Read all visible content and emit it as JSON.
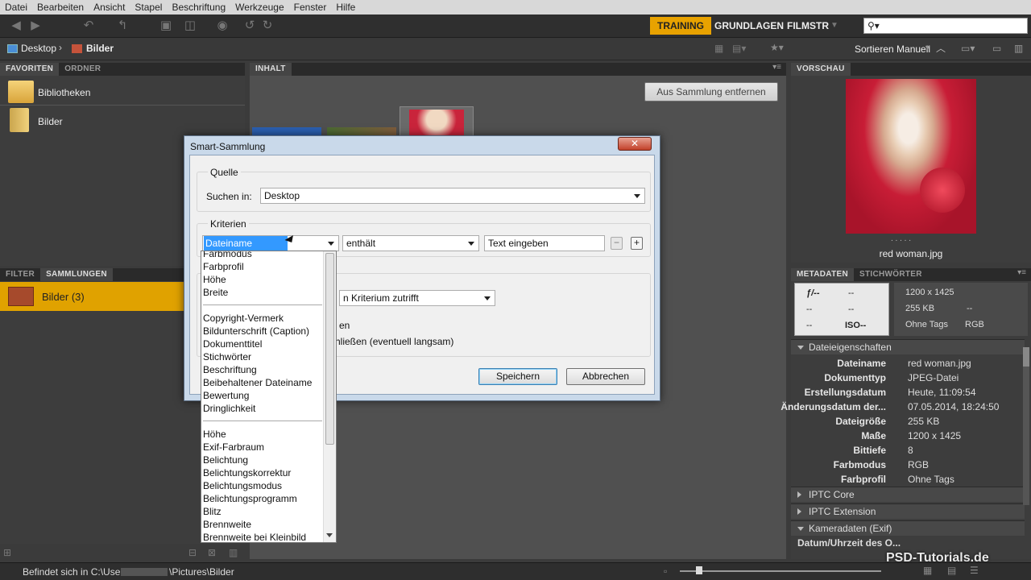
{
  "menu": [
    "Datei",
    "Bearbeiten",
    "Ansicht",
    "Stapel",
    "Beschriftung",
    "Werkzeuge",
    "Fenster",
    "Hilfe"
  ],
  "workspaces": {
    "training": "TRAINING",
    "grundlagen": "GRUNDLAGEN",
    "filmstr": "FILMSTR"
  },
  "path": {
    "desktop": "Desktop",
    "bilder": "Bilder"
  },
  "sort_label": "Sortieren Manuell",
  "favorites": {
    "tab1": "FAVORITEN",
    "tab2": "ORDNER",
    "items": [
      "Bibliotheken",
      "Bilder"
    ]
  },
  "content": {
    "tab": "INHALT",
    "remove_button": "Aus Sammlung entfernen"
  },
  "collections": {
    "tab1": "FILTER",
    "tab2": "SAMMLUNGEN",
    "item": "Bilder (3)"
  },
  "preview": {
    "tab": "VORSCHAU",
    "filename": "red woman.jpg",
    "dots": ". . . . ."
  },
  "metadata": {
    "tab1": "METADATEN",
    "tab2": "STICHWÖRTER",
    "summary": {
      "f": "ƒ/--",
      "f_val": "--",
      "r2a": "--",
      "r2b": "--",
      "r3a": "--",
      "iso": "ISO--",
      "dims": "1200 x 1425",
      "size": "255 KB",
      "size2": "--",
      "tags": "Ohne Tags",
      "mode": "RGB"
    },
    "section_file": "Dateieigenschaften",
    "rows": [
      {
        "k": "Dateiname",
        "v": "red woman.jpg"
      },
      {
        "k": "Dokumenttyp",
        "v": "JPEG-Datei"
      },
      {
        "k": "Erstellungsdatum",
        "v": "Heute, 11:09:54"
      },
      {
        "k": "Änderungsdatum der...",
        "v": "07.05.2014, 18:24:50"
      },
      {
        "k": "Dateigröße",
        "v": "255 KB"
      },
      {
        "k": "Maße",
        "v": "1200 x 1425"
      },
      {
        "k": "Bittiefe",
        "v": "8"
      },
      {
        "k": "Farbmodus",
        "v": "RGB"
      },
      {
        "k": "Farbprofil",
        "v": "Ohne Tags"
      }
    ],
    "sections": [
      "IPTC Core",
      "IPTC Extension",
      "Kameradaten (Exif)"
    ],
    "last_row": "Datum/Uhrzeit des O..."
  },
  "status": {
    "prefix": "Befindet sich in C:\\Users\\",
    "suffix": "\\Pictures\\Bilder"
  },
  "watermark": "PSD-Tutorials.de",
  "dialog": {
    "title": "Smart-Sammlung",
    "source_group": "Quelle",
    "search_in_label": "Suchen in:",
    "search_in_value": "Desktop",
    "criteria_group": "Kriterien",
    "field": "Dateiname",
    "operator": "enthält",
    "text_placeholder": "Text eingeben",
    "result_combo": "n Kriterium zutrifft",
    "option1": "en",
    "option2": "schließen (eventuell langsam)",
    "save": "Speichern",
    "cancel": "Abbrechen"
  },
  "dropdown_items": [
    [
      "Farbmodus",
      "Farbprofil",
      "Höhe",
      "Breite"
    ],
    [
      "Copyright-Vermerk",
      "Bildunterschrift (Caption)",
      "Dokumenttitel",
      "Stichwörter",
      "Beschriftung",
      "Beibehaltener Dateiname",
      "Bewertung",
      "Dringlichkeit"
    ],
    [
      "Höhe",
      "Exif-Farbraum",
      "Belichtung",
      "Belichtungskorrektur",
      "Belichtungsmodus",
      "Belichtungsprogramm",
      "Blitz",
      "Brennweite",
      "Brennweite bei Kleinbild"
    ]
  ]
}
